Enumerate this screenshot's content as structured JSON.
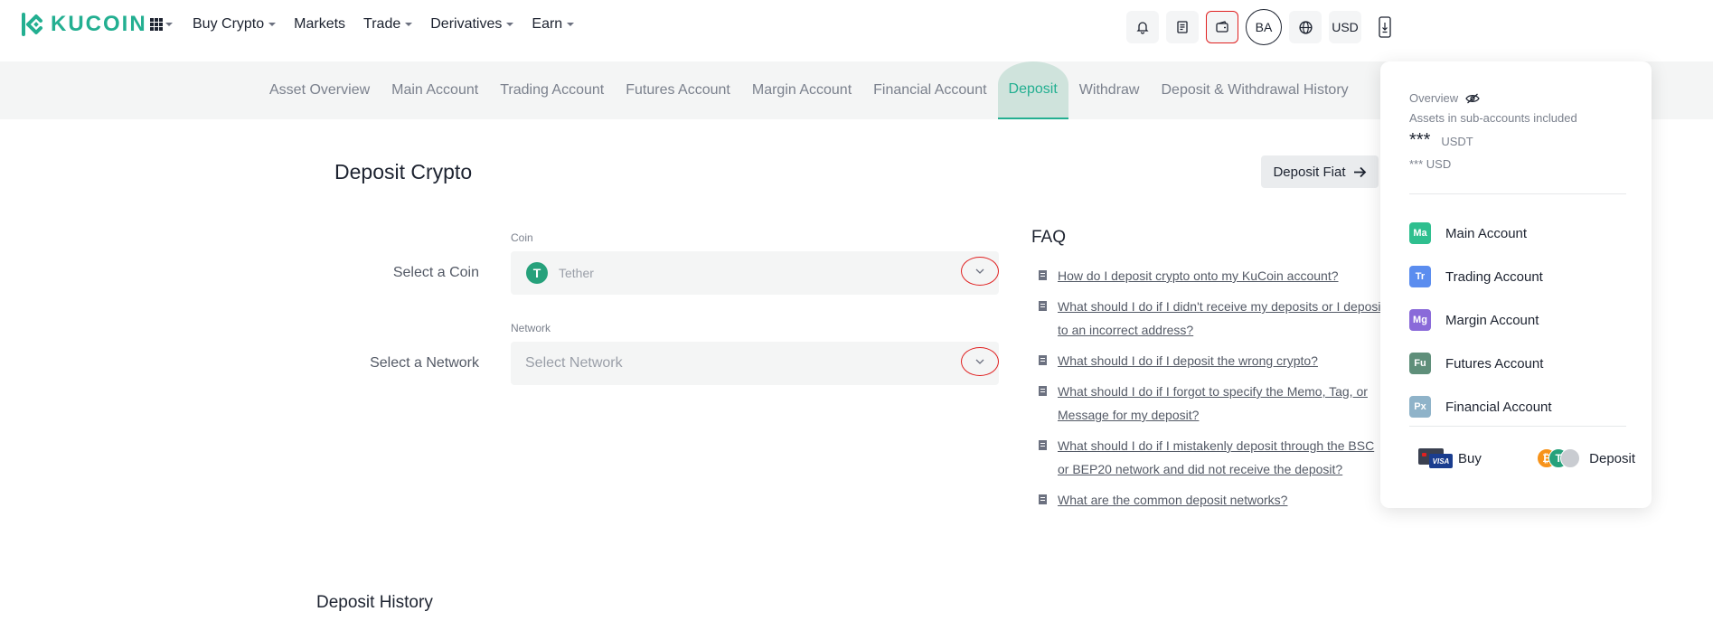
{
  "brand": {
    "name": "KUCOIN",
    "color": "#23af91"
  },
  "header": {
    "nav": [
      {
        "label": "Buy Crypto",
        "has_caret": true
      },
      {
        "label": "Markets",
        "has_caret": false
      },
      {
        "label": "Trade",
        "has_caret": true
      },
      {
        "label": "Derivatives",
        "has_caret": true
      },
      {
        "label": "Earn",
        "has_caret": true
      }
    ],
    "avatar_initials": "BA",
    "currency": "USD",
    "icons": [
      "bell-icon",
      "orders-icon",
      "wallet-icon",
      "globe-icon",
      "download-icon"
    ]
  },
  "subnav": {
    "items": [
      {
        "label": "Asset Overview"
      },
      {
        "label": "Main Account"
      },
      {
        "label": "Trading Account"
      },
      {
        "label": "Futures Account"
      },
      {
        "label": "Margin Account"
      },
      {
        "label": "Financial Account"
      },
      {
        "label": "Deposit",
        "active": true
      },
      {
        "label": "Withdraw"
      },
      {
        "label": "Deposit & Withdrawal History"
      }
    ]
  },
  "main": {
    "title": "Deposit Crypto",
    "fiat_button": "Deposit Fiat",
    "coin": {
      "row_label": "Select a Coin",
      "caption": "Coin",
      "value": "Tether",
      "icon_letter": "T"
    },
    "network": {
      "row_label": "Select a Network",
      "caption": "Network",
      "placeholder": "Select Network"
    },
    "faq": {
      "title": "FAQ",
      "items": [
        "How do I deposit crypto onto my KuCoin account?",
        "What should I do if I didn't receive my deposits or I deposit to an incorrect address?",
        "What should I do if I deposit the wrong crypto?",
        "What should I do if I forgot to specify the Memo, Tag, or Message for my deposit?",
        "What should I do if I mistakenly deposit through the BSC or BEP20 network and did not receive the deposit?",
        "What are the common deposit networks?"
      ]
    },
    "history_title": "Deposit History"
  },
  "wallet_panel": {
    "overview_label": "Overview",
    "subaccounts_note": "Assets in sub-accounts included",
    "balance_masked": "***",
    "balance_unit": "USDT",
    "usd_masked": "*** USD",
    "accounts": [
      {
        "badge": "Ma",
        "label": "Main Account",
        "color": "#2fbf8f"
      },
      {
        "badge": "Tr",
        "label": "Trading Account",
        "color": "#5b8def"
      },
      {
        "badge": "Mg",
        "label": "Margin Account",
        "color": "#8a6ad9"
      },
      {
        "badge": "Fu",
        "label": "Futures Account",
        "color": "#5f8f7a"
      },
      {
        "badge": "Px",
        "label": "Financial Account",
        "color": "#8fb3c9"
      }
    ],
    "buy_label": "Buy",
    "deposit_label": "Deposit",
    "card_brand": "VISA",
    "coin_letters": [
      "₿",
      "T"
    ]
  }
}
